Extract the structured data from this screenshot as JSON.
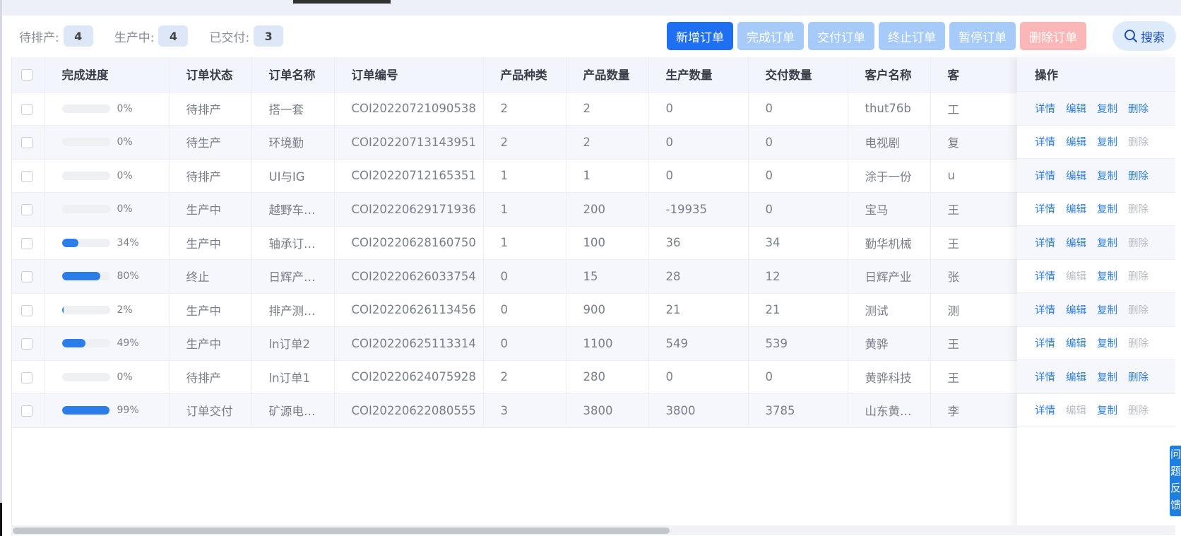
{
  "stats": [
    {
      "label": "待排产:",
      "value": "4"
    },
    {
      "label": "生产中:",
      "value": "4"
    },
    {
      "label": "已交付:",
      "value": "3"
    }
  ],
  "toolbar": {
    "new_order": "新增订单",
    "complete_order": "完成订单",
    "deliver_order": "交付订单",
    "terminate_order": "终止订单",
    "pause_order": "暂停订单",
    "delete_order": "删除订单",
    "search": "搜索"
  },
  "columns": {
    "progress": "完成进度",
    "status": "订单状态",
    "name": "订单名称",
    "code": "订单编号",
    "types": "产品种类",
    "qty": "产品数量",
    "produced": "生产数量",
    "delivered": "交付数量",
    "customer": "客户名称",
    "contact": "客",
    "ops": "操作"
  },
  "rows": [
    {
      "progress": 0,
      "progress_text": "0%",
      "status": "待排产",
      "name": "搭一套",
      "code": "COI20220721090538",
      "types": "2",
      "qty": "2",
      "produced": "0",
      "delivered": "0",
      "customer": "thut76b",
      "contact": "工",
      "delete_enabled": true
    },
    {
      "progress": 0,
      "progress_text": "0%",
      "status": "待生产",
      "name": "环境勤",
      "code": "COI20220713143951",
      "types": "2",
      "qty": "2",
      "produced": "0",
      "delivered": "0",
      "customer": "电视剧",
      "contact": "复",
      "delete_enabled": false
    },
    {
      "progress": 0,
      "progress_text": "0%",
      "status": "待排产",
      "name": "UI与IG",
      "code": "COI20220712165351",
      "types": "1",
      "qty": "1",
      "produced": "0",
      "delivered": "0",
      "customer": "涂于一份",
      "contact": "u",
      "delete_enabled": true
    },
    {
      "progress": 0,
      "progress_text": "0%",
      "status": "生产中",
      "name": "越野车…",
      "code": "COI20220629171936",
      "types": "1",
      "qty": "200",
      "produced": "-19935",
      "delivered": "0",
      "customer": "宝马",
      "contact": "王",
      "delete_enabled": false
    },
    {
      "progress": 34,
      "progress_text": "34%",
      "status": "生产中",
      "name": "轴承订…",
      "code": "COI20220628160750",
      "types": "1",
      "qty": "100",
      "produced": "36",
      "delivered": "34",
      "customer": "勤华机械",
      "contact": "王",
      "delete_enabled": false
    },
    {
      "progress": 80,
      "progress_text": "80%",
      "status": "终止",
      "name": "日辉产…",
      "code": "COI20220626033754",
      "types": "0",
      "qty": "15",
      "produced": "28",
      "delivered": "12",
      "customer": "日辉产业",
      "contact": "张",
      "delete_enabled": false,
      "edit_enabled": false
    },
    {
      "progress": 2,
      "progress_text": "2%",
      "status": "生产中",
      "name": "排产测…",
      "code": "COI20220626113456",
      "types": "0",
      "qty": "900",
      "produced": "21",
      "delivered": "21",
      "customer": "测试",
      "contact": "测",
      "delete_enabled": false
    },
    {
      "progress": 49,
      "progress_text": "49%",
      "status": "生产中",
      "name": "ln订单2",
      "code": "COI20220625113314",
      "types": "0",
      "qty": "1100",
      "produced": "549",
      "delivered": "539",
      "customer": "黄骅",
      "contact": "王",
      "delete_enabled": false
    },
    {
      "progress": 0,
      "progress_text": "0%",
      "status": "待排产",
      "name": "ln订单1",
      "code": "COI20220624075928",
      "types": "2",
      "qty": "280",
      "produced": "0",
      "delivered": "0",
      "customer": "黄骅科技",
      "contact": "王",
      "delete_enabled": true
    },
    {
      "progress": 99,
      "progress_text": "99%",
      "status": "订单交付",
      "name": "矿源电…",
      "code": "COI20220622080555",
      "types": "3",
      "qty": "3800",
      "produced": "3800",
      "delivered": "3785",
      "customer": "山东黄…",
      "contact": "李",
      "delete_enabled": false,
      "edit_enabled": false
    }
  ],
  "ops": {
    "detail": "详情",
    "edit": "编辑",
    "copy": "复制",
    "delete": "删除"
  },
  "feedback": "问题反馈",
  "colors": {
    "accent": "#1f6ff2",
    "progress": "#2b7de9",
    "link": "#2f7fe0",
    "danger_light": "#fbb7b7"
  }
}
